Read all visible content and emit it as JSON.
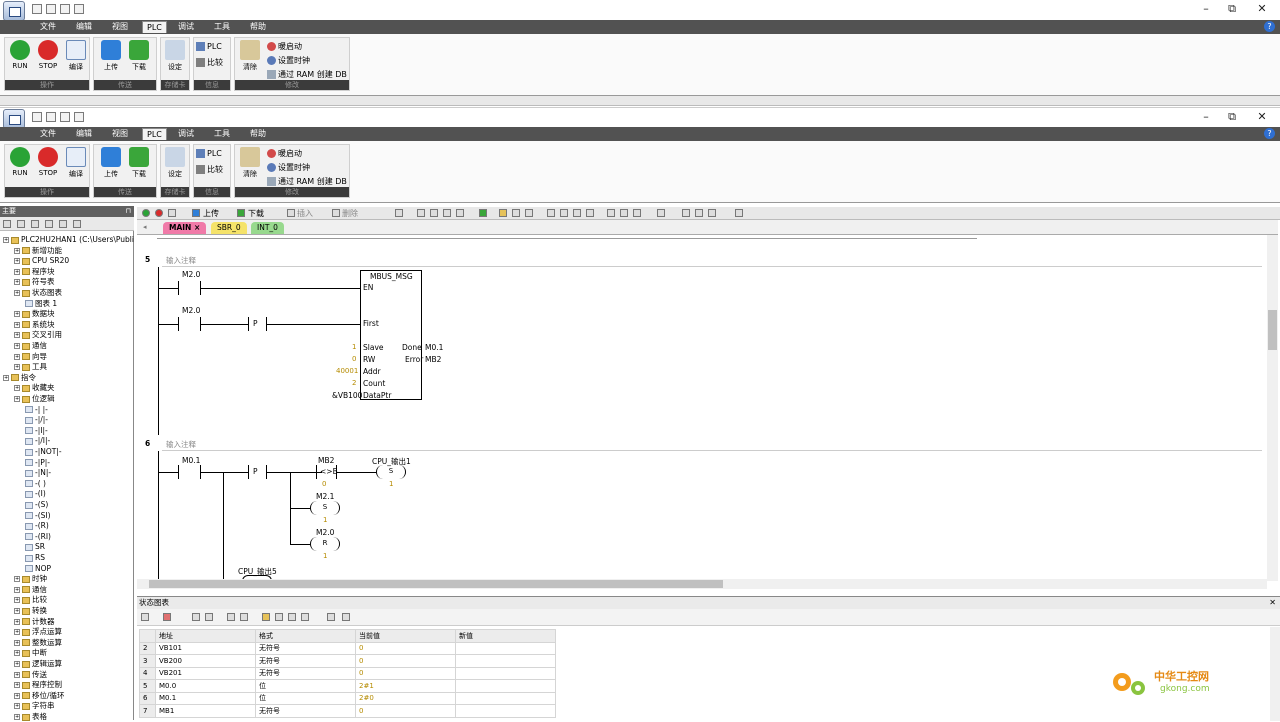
{
  "app": {
    "menus": [
      "文件",
      "编辑",
      "视图",
      "PLC",
      "调试",
      "工具",
      "帮助"
    ],
    "active_menu": "PLC",
    "minimize": "–",
    "restore": "⧉",
    "close": "✕",
    "help": "?"
  },
  "ribbon": {
    "groups": {
      "operate": "操作",
      "transfer": "传送",
      "memory_card": "存储卡",
      "info": "信息",
      "modify": "修改"
    },
    "buttons": {
      "run": "RUN",
      "stop": "STOP",
      "compile": "编译",
      "upload": "上传",
      "download": "下载",
      "setup": "设定",
      "plc": "PLC",
      "compare": "比较",
      "clear": "清除",
      "power_up_reset": "暖启动",
      "set_clock": "设置时钟",
      "ram_to_db": "通过 RAM 创建 DB"
    }
  },
  "toolbar": {
    "upload": "上传",
    "download": "下载",
    "insert": "插入",
    "delete": "删除"
  },
  "left_panel": {
    "title": "主要",
    "pin": "⊓",
    "tree": [
      {
        "indent": 0,
        "label": "PLC2HU2HAN1 (C:\\Users\\Publi"
      },
      {
        "indent": 1,
        "label": "新增功能"
      },
      {
        "indent": 1,
        "label": "CPU SR20"
      },
      {
        "indent": 1,
        "label": "程序块"
      },
      {
        "indent": 1,
        "label": "符号表"
      },
      {
        "indent": 1,
        "label": "状态图表"
      },
      {
        "indent": 2,
        "label": "图表 1"
      },
      {
        "indent": 1,
        "label": "数据块"
      },
      {
        "indent": 1,
        "label": "系统块"
      },
      {
        "indent": 1,
        "label": "交叉引用"
      },
      {
        "indent": 1,
        "label": "通信"
      },
      {
        "indent": 1,
        "label": "向导"
      },
      {
        "indent": 1,
        "label": "工具"
      },
      {
        "indent": 0,
        "label": "指令"
      },
      {
        "indent": 1,
        "label": "收藏夹"
      },
      {
        "indent": 1,
        "label": "位逻辑"
      },
      {
        "indent": 2,
        "label": "-| |-"
      },
      {
        "indent": 2,
        "label": "-|/|-"
      },
      {
        "indent": 2,
        "label": "-|I|-"
      },
      {
        "indent": 2,
        "label": "-|/I|-"
      },
      {
        "indent": 2,
        "label": "-|NOT|-"
      },
      {
        "indent": 2,
        "label": "-|P|-"
      },
      {
        "indent": 2,
        "label": "-|N|-"
      },
      {
        "indent": 2,
        "label": "-( )"
      },
      {
        "indent": 2,
        "label": "-(I)"
      },
      {
        "indent": 2,
        "label": "-(S)"
      },
      {
        "indent": 2,
        "label": "-(SI)"
      },
      {
        "indent": 2,
        "label": "-(R)"
      },
      {
        "indent": 2,
        "label": "-(RI)"
      },
      {
        "indent": 2,
        "label": "SR"
      },
      {
        "indent": 2,
        "label": "RS"
      },
      {
        "indent": 2,
        "label": "NOP"
      },
      {
        "indent": 1,
        "label": "时钟"
      },
      {
        "indent": 1,
        "label": "通信"
      },
      {
        "indent": 1,
        "label": "比较"
      },
      {
        "indent": 1,
        "label": "转换"
      },
      {
        "indent": 1,
        "label": "计数器"
      },
      {
        "indent": 1,
        "label": "浮点运算"
      },
      {
        "indent": 1,
        "label": "整数运算"
      },
      {
        "indent": 1,
        "label": "中断"
      },
      {
        "indent": 1,
        "label": "逻辑运算"
      },
      {
        "indent": 1,
        "label": "传送"
      },
      {
        "indent": 1,
        "label": "程序控制"
      },
      {
        "indent": 1,
        "label": "移位/循环"
      },
      {
        "indent": 1,
        "label": "字符串"
      },
      {
        "indent": 1,
        "label": "表格"
      }
    ]
  },
  "editor": {
    "tabs": [
      "MAIN",
      "SBR_0",
      "INT_0"
    ],
    "tab_close": "×",
    "comment_placeholder": "输入注释",
    "rung5": {
      "number": "5",
      "contact1": "M2.0",
      "contact2": "M2.0",
      "p_label": "P",
      "block_title": "MBUS_MSG",
      "pins_left": [
        "EN",
        "First",
        "Slave",
        "RW",
        "Addr",
        "Count",
        "DataPtr"
      ],
      "pins_right": [
        "Done",
        "Error"
      ],
      "inputs": {
        "slave": "1",
        "rw": "0",
        "addr": "40001",
        "count": "2",
        "dataptr": "&VB100"
      },
      "outputs": {
        "done": "M0.1",
        "error": "MB2"
      }
    },
    "rung6": {
      "number": "6",
      "contact1": "M0.1",
      "p_label": "P",
      "compare_addr": "MB2",
      "compare_op": "<>B",
      "compare_val": "0",
      "coil1_label": "CPU_输出1",
      "coil1_type": "S",
      "coil1_val": "1",
      "coil2_addr": "M2.1",
      "coil2_type": "S",
      "coil2_val": "1",
      "coil3_addr": "M2.0",
      "coil3_type": "R",
      "coil3_val": "1",
      "bottom_label": "CPU_输出5"
    }
  },
  "status_chart": {
    "title": "状态图表",
    "headers": [
      "",
      "地址",
      "格式",
      "当前值",
      "新值"
    ],
    "rows": [
      [
        "2",
        "VB101",
        "无符号",
        "0",
        ""
      ],
      [
        "3",
        "VB200",
        "无符号",
        "0",
        ""
      ],
      [
        "4",
        "VB201",
        "无符号",
        "0",
        ""
      ],
      [
        "5",
        "M0.0",
        "位",
        "2#1",
        ""
      ],
      [
        "6",
        "M0.1",
        "位",
        "2#0",
        ""
      ],
      [
        "7",
        "MB1",
        "无符号",
        "0",
        ""
      ]
    ]
  },
  "watermark": {
    "brand": "中华工控网",
    "url": "gkong.com"
  },
  "colors": {
    "accent": "#2f6fd2",
    "menubar": "#525252",
    "value": "#b58b00",
    "tab_main": "#f07aa8"
  }
}
